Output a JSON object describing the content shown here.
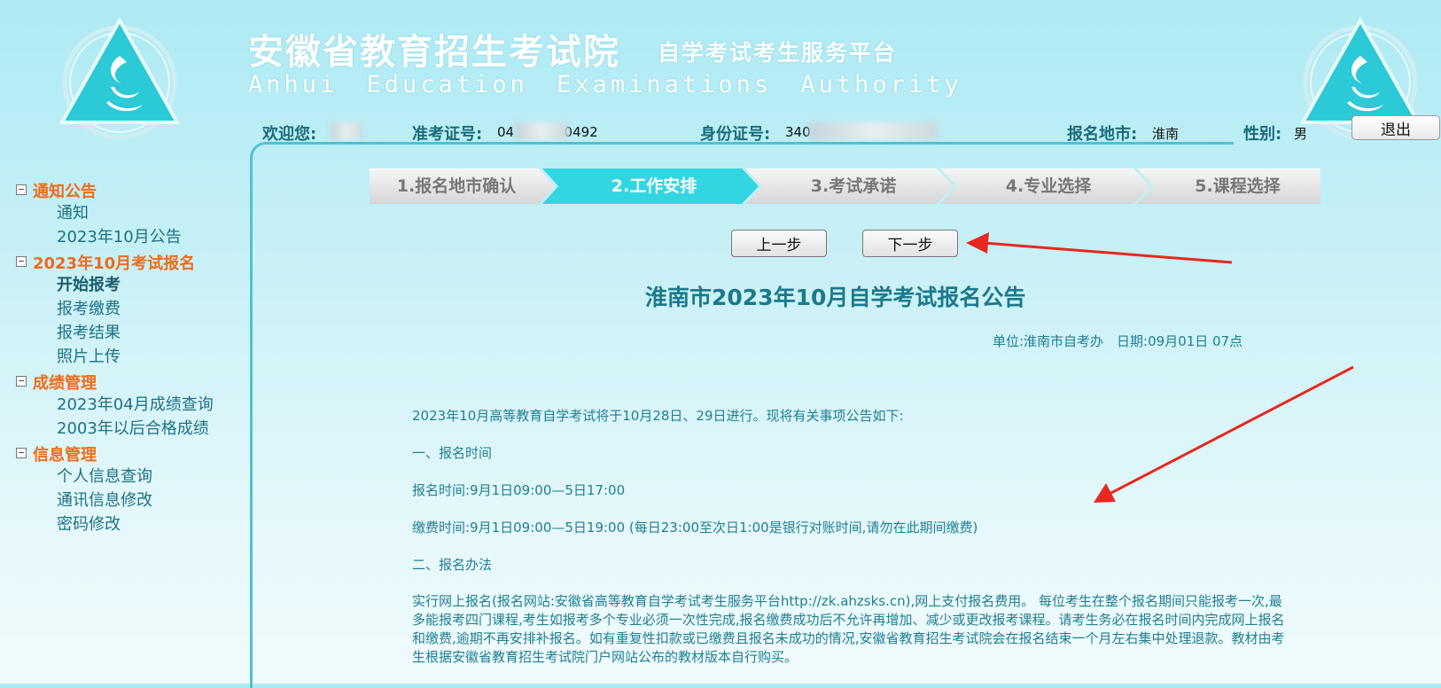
{
  "header": {
    "title_cn": "安徽省教育招生考试院",
    "subtitle_cn": "自学考试考生服务平台",
    "title_en": "Anhui  Education  Examinations  Authority"
  },
  "userinfo": {
    "welcome_label": "欢迎您:",
    "exam_no_label": "准考证号:",
    "exam_no_value": "04",
    "exam_no_tail": "00492",
    "id_label": "身份证号:",
    "id_value": "340",
    "region_label": "报名地市:",
    "region_value": "淮南",
    "gender_label": "性别:",
    "gender_value": "男"
  },
  "logout_label": "退出",
  "sidebar": {
    "groups": [
      {
        "label": "通知公告",
        "toggle": "−",
        "items": [
          "通知",
          "2023年10月公告"
        ]
      },
      {
        "label": "2023年10月考试报名",
        "toggle": "−",
        "items": [
          "开始报考",
          "报考缴费",
          "报考结果",
          "照片上传"
        ],
        "active": "开始报考"
      },
      {
        "label": "成绩管理",
        "toggle": "−",
        "items": [
          "2023年04月成绩查询",
          "2003年以后合格成绩"
        ]
      },
      {
        "label": "信息管理",
        "toggle": "−",
        "items": [
          "个人信息查询",
          "通讯信息修改",
          "密码修改"
        ]
      }
    ]
  },
  "steps": [
    {
      "label": "1.报名地市确认",
      "active": false
    },
    {
      "label": "2.工作安排",
      "active": true
    },
    {
      "label": "3.考试承诺",
      "active": false
    },
    {
      "label": "4.专业选择",
      "active": false
    },
    {
      "label": "5.课程选择",
      "active": false
    }
  ],
  "buttons": {
    "prev": "上一步",
    "next": "下一步"
  },
  "notice": {
    "title": "淮南市2023年10月自学考试报名公告",
    "meta": "单位:淮南市自考办　日期:09月01日 07点",
    "intro": "2023年10月高等教育自学考试将于10月28日、29日进行。现将有关事项公告如下:",
    "section1": "一、报名时间",
    "reg_time": "报名时间:9月1日09:00—5日17:00",
    "pay_time": "缴费时间:9月1日09:00—5日19:00 (每日23:00至次日1:00是银行对账时间,请勿在此期间缴费)",
    "section2": "二、报名办法",
    "method": "实行网上报名(报名网站:安徽省高等教育自学考试考生服务平台http://zk.ahzsks.cn),网上支付报名费用。 每位考生在整个报名期间只能报考一次,最多能报考四门课程,考生如报考多个专业必须一次性完成,报名缴费成功后不允许再增加、减少或更改报考课程。请考生务必在报名时间内完成网上报名和缴费,逾期不再安排补报名。如有重复性扣款或已缴费且报名未成功的情况,安徽省教育招生考试院会在报名结束一个月左右集中处理退款。教材由考生根据安徽省教育招生考试院门户网站公布的教材版本自行购买。"
  },
  "colors": {
    "accent": "#33d6e0",
    "frame": "#4fc2d5",
    "group_label": "#f06b1c",
    "text": "#1f7f92",
    "arrow": "#e8271f"
  },
  "icons": [
    "logo-emblem",
    "collapse-toggle",
    "red-arrow-annotation"
  ]
}
